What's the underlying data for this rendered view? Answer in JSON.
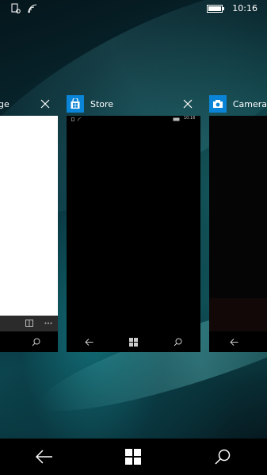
{
  "status_bar": {
    "time": "10:16",
    "icons": [
      "notification-icon",
      "wifi-icon",
      "battery-icon"
    ]
  },
  "task_switcher": {
    "cards": [
      {
        "title": "ge",
        "icon": "browser-icon"
      },
      {
        "title": "Store",
        "icon": "store-icon",
        "mini_time": "10:16"
      },
      {
        "title": "Camera",
        "icon": "camera-icon"
      }
    ]
  },
  "nav_bar": {
    "buttons": [
      "back-icon",
      "windows-start-icon",
      "search-icon"
    ]
  },
  "colors": {
    "app_icon_blue": "#0a84d6",
    "background_teal": "#0d4a52"
  }
}
